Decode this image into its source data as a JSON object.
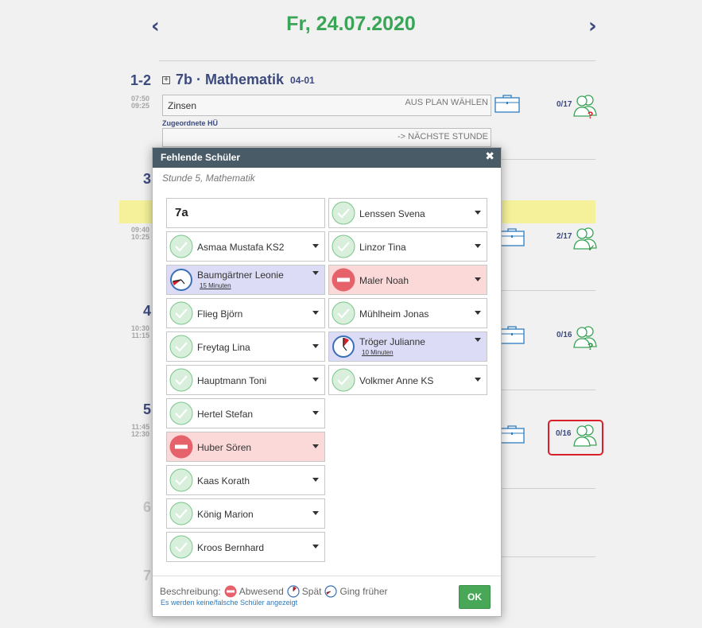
{
  "header": {
    "date": "Fr, 24.07.2020",
    "prev_arrow": "‹",
    "next_arrow": "›"
  },
  "periods": [
    {
      "num": "1-2",
      "start": "07:50",
      "end": "09:25"
    },
    {
      "num": "3",
      "start": "09:40",
      "end": "10:25"
    },
    {
      "num": "4",
      "start": "10:30",
      "end": "11:15"
    },
    {
      "num": "5",
      "start": "11:45",
      "end": "12:30"
    },
    {
      "num": "6"
    },
    {
      "num": "7"
    }
  ],
  "lesson": {
    "expand": "+",
    "title": "7b · Mathematik",
    "room": "04-01",
    "topic": "Zinsen",
    "topic_action": "AUS PLAN WÄHLEN",
    "homework_label": "Zugeordnete HÜ",
    "homework_action": "-> NÄCHSTE STUNDE"
  },
  "counts": [
    "0/17",
    "2/17",
    "0/16",
    "0/16"
  ],
  "count_marks": [
    "?",
    "✓",
    "?"
  ],
  "modal": {
    "title": "Fehlende Schüler",
    "close": "✖",
    "subtitle": "Stunde 5, Mathematik",
    "class_name": "7a",
    "students_left": [
      {
        "name": "Asmaa Mustafa KS2",
        "status": "present"
      },
      {
        "name": "Baumgärtner Leonie",
        "status": "left-early",
        "sub": "15 Minuten"
      },
      {
        "name": "Flieg Björn",
        "status": "present"
      },
      {
        "name": "Freytag Lina",
        "status": "present"
      },
      {
        "name": "Hauptmann Toni",
        "status": "present"
      },
      {
        "name": "Hertel Stefan",
        "status": "present"
      },
      {
        "name": "Huber Sören",
        "status": "absent"
      },
      {
        "name": "Kaas Korath",
        "status": "present"
      },
      {
        "name": "König Marion",
        "status": "present"
      },
      {
        "name": "Kroos Bernhard",
        "status": "present"
      }
    ],
    "students_right": [
      {
        "name": "Lenssen Svena",
        "status": "present"
      },
      {
        "name": "Linzor Tina",
        "status": "present"
      },
      {
        "name": "Maler Noah",
        "status": "absent"
      },
      {
        "name": "Mühlheim Jonas",
        "status": "present"
      },
      {
        "name": "Tröger Julianne",
        "status": "late",
        "sub": "10 Minuten"
      },
      {
        "name": "Volkmer Anne KS",
        "status": "present"
      }
    ],
    "legend_label": "Beschreibung:",
    "legend_absent": "Abwesend",
    "legend_late": "Spät",
    "legend_left": "Ging früher",
    "wrong_students_link": "Es werden keine/falsche Schüler angezeigt",
    "ok_label": "OK"
  },
  "colors": {
    "accent_green": "#3aa556",
    "navy": "#3c4a7e",
    "absent_red": "#e5626b",
    "highlight_red": "#d9202a"
  }
}
